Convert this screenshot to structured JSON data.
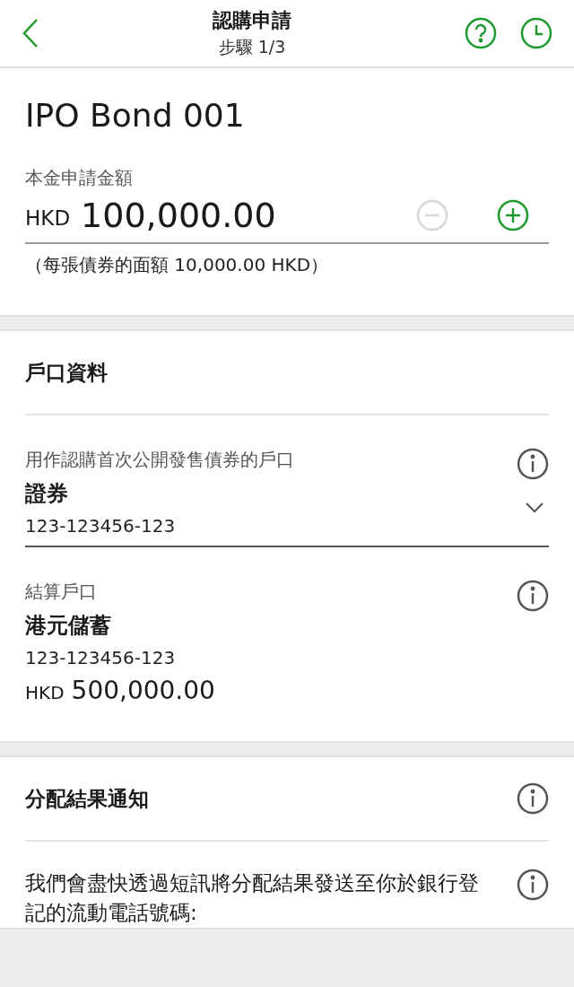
{
  "header": {
    "title": "認購申請",
    "step": "步驟 1/3"
  },
  "product": {
    "name": "IPO Bond 001",
    "amount_label": "本金申請金額",
    "currency": "HKD",
    "amount": "100,000.00",
    "decrease_disabled": true,
    "increase_disabled": false,
    "note": "（每張債券的面額 10,000.00 HKD）"
  },
  "account_section": {
    "title": "戶口資料",
    "fields": [
      {
        "kind": "select",
        "label": "用作認購首次公開發售債券的戶口",
        "name": "證券",
        "number": "123-123456-123"
      },
      {
        "kind": "static",
        "label": "結算戶口",
        "name": "港元儲蓄",
        "number": "123-123456-123",
        "currency": "HKD",
        "balance": "500,000.00"
      }
    ]
  },
  "notification_section": {
    "title": "分配結果通知",
    "message": "我們會盡快透過短訊將分配結果發送至你於銀行登記的流動電話號碼:"
  }
}
